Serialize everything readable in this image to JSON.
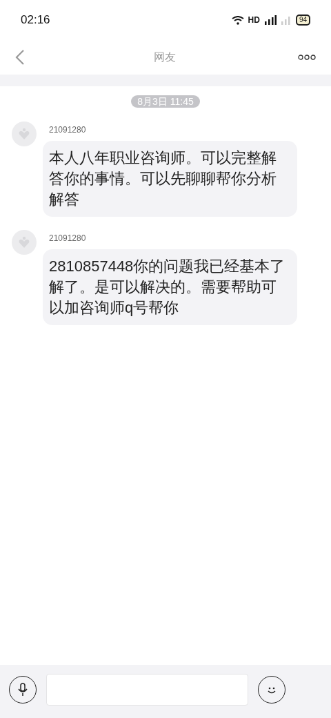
{
  "status_bar": {
    "time": "02:16",
    "network": "HD",
    "battery": "94"
  },
  "nav": {
    "title": "网友"
  },
  "date_divider": "8月3日 11:45",
  "messages": [
    {
      "sender": "21091280",
      "text": "本人八年职业咨询师。可以完整解答你的事情。可以先聊聊帮你分析解答"
    },
    {
      "sender": "21091280",
      "text": "2810857448你的问题我已经基本了解了。是可以解决的。需要帮助可以加咨询师q号帮你"
    }
  ]
}
